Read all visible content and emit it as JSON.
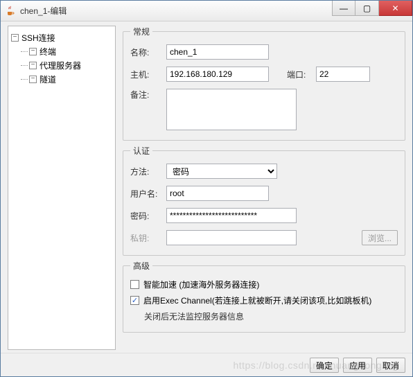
{
  "window": {
    "title": "chen_1-编辑"
  },
  "win_btns": {
    "min": "—",
    "max": "▢",
    "close": "✕"
  },
  "tree": {
    "root": "SSH连接",
    "items": [
      "终端",
      "代理服务器",
      "隧道"
    ]
  },
  "general": {
    "legend": "常规",
    "name_lbl": "名称:",
    "name_val": "chen_1",
    "host_lbl": "主机:",
    "host_val": "192.168.180.129",
    "port_lbl": "端口:",
    "port_val": "22",
    "note_lbl": "备注:",
    "note_val": ""
  },
  "auth": {
    "legend": "认证",
    "method_lbl": "方法:",
    "method_val": "密码",
    "user_lbl": "用户名:",
    "user_val": "root",
    "pass_lbl": "密码:",
    "pass_val": "***************************",
    "key_lbl": "私钥:",
    "key_val": "",
    "browse": "浏览..."
  },
  "advanced": {
    "legend": "高级",
    "accel": "智能加速 (加速海外服务器连接)",
    "exec": "启用Exec Channel(若连接上就被断开,请关闭该项,比如跳板机)",
    "exec_sub": "关闭后无法监控服务器信息",
    "accel_checked": false,
    "exec_checked": true
  },
  "footer": {
    "ok": "确定",
    "apply": "应用",
    "cancel": "取消"
  },
  "icons": {
    "toggle": "−"
  },
  "watermark": "https://blog.csdn.net/huangdongling"
}
